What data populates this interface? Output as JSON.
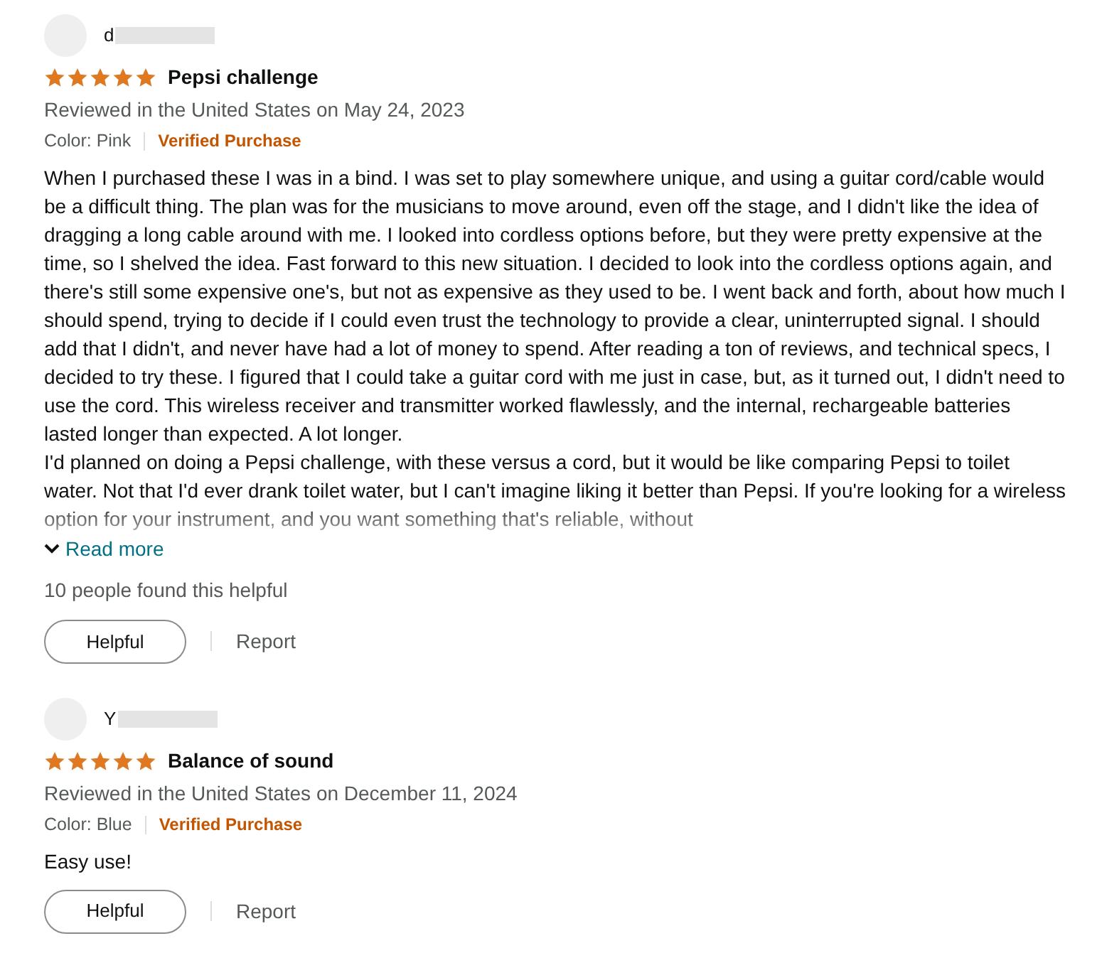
{
  "reviews": [
    {
      "author": "d",
      "stars": 5,
      "title": "Pepsi challenge",
      "date": "Reviewed in the United States on May 24, 2023",
      "variant": "Color: Pink",
      "badge": "Verified Purchase",
      "body": [
        "When I purchased these I was in a bind. I was set to play somewhere unique, and using a guitar cord/cable would be a difficult thing. The plan was for the musicians to move around, even off the stage, and I didn't like the idea of dragging a long cable around with me. I looked into cordless options before, but they were pretty expensive at the time, so I shelved the idea. Fast forward to this new situation. I decided to look into the cordless options again, and there's still some expensive one's, but not as expensive as they used to be. I went back and forth, about how much I should spend, trying to decide if I could even trust the technology to provide a clear, uninterrupted signal. I should add that I didn't, and never have had a lot of money to spend. After reading a ton of reviews, and technical specs, I decided to try these. I figured that I could take a guitar cord with me just in case, but, as it turned out, I didn't need to use the cord. This wireless receiver and transmitter worked flawlessly, and the internal, rechargeable batteries lasted longer than expected. A lot longer.",
        "I'd planned on doing a Pepsi challenge, with these versus a cord, but it would be like comparing Pepsi to toilet water. Not that I'd ever drank toilet water, but I can't imagine liking it better than Pepsi. If you're looking for a wireless option for your instrument, and you want something that's reliable, without"
      ],
      "truncated": true,
      "read_more": "Read more",
      "helpful_count": "10 people found this helpful",
      "helpful_button": "Helpful",
      "report": "Report"
    },
    {
      "author": "Y",
      "stars": 5,
      "title": "Balance of sound",
      "date": "Reviewed in the United States on December 11, 2024",
      "variant": "Color: Blue",
      "badge": "Verified Purchase",
      "body": [
        "Easy use!"
      ],
      "truncated": false,
      "helpful_button": "Helpful",
      "report": "Report"
    }
  ]
}
